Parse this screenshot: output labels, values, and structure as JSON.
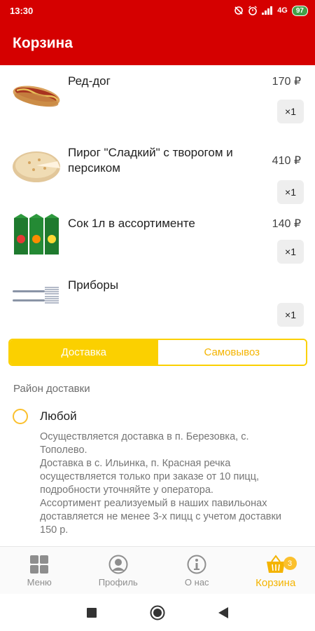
{
  "status_bar": {
    "time": "13:30",
    "network": "4G",
    "battery": "97"
  },
  "app_bar": {
    "title": "Корзина"
  },
  "cart": {
    "items": [
      {
        "name": "Ред-дог",
        "price": "170 ₽",
        "qty": "×1",
        "icon": "hot-dog-image"
      },
      {
        "name": "Пирог \"Сладкий\" с творогом и персиком",
        "price": "410 ₽",
        "qty": "×1",
        "icon": "pie-image"
      },
      {
        "name": "Сок 1л в ассортименте",
        "price": "140 ₽",
        "qty": "×1",
        "icon": "juice-image"
      },
      {
        "name": "Приборы",
        "price": "",
        "qty": "×1",
        "icon": "cutlery-image"
      }
    ]
  },
  "delivery_toggle": {
    "delivery_label": "Доставка",
    "pickup_label": "Самовывоз",
    "selected": "delivery"
  },
  "district": {
    "section_label": "Район доставки",
    "option_label": "Любой",
    "description": "Осуществляется доставка в п. Березовка, с. Тополево.\nДоставка в с. Ильинка, п. Красная речка осуществляется только при заказе от 10 пицц, подробности уточняйте у оператора.\nАссортимент реализуемый в наших павильонах доставляется не менее 3-х пицц с учетом доставки 150 р."
  },
  "bottom_nav": {
    "items": [
      {
        "label": "Меню",
        "icon": "grid-menu-icon"
      },
      {
        "label": "Профиль",
        "icon": "profile-icon"
      },
      {
        "label": "О нас",
        "icon": "info-icon"
      },
      {
        "label": "Корзина",
        "icon": "basket-icon",
        "badge": "3",
        "active": true
      }
    ]
  },
  "colors": {
    "primary": "#d50000",
    "accent": "#fbd000",
    "accent_text": "#f4b400"
  }
}
